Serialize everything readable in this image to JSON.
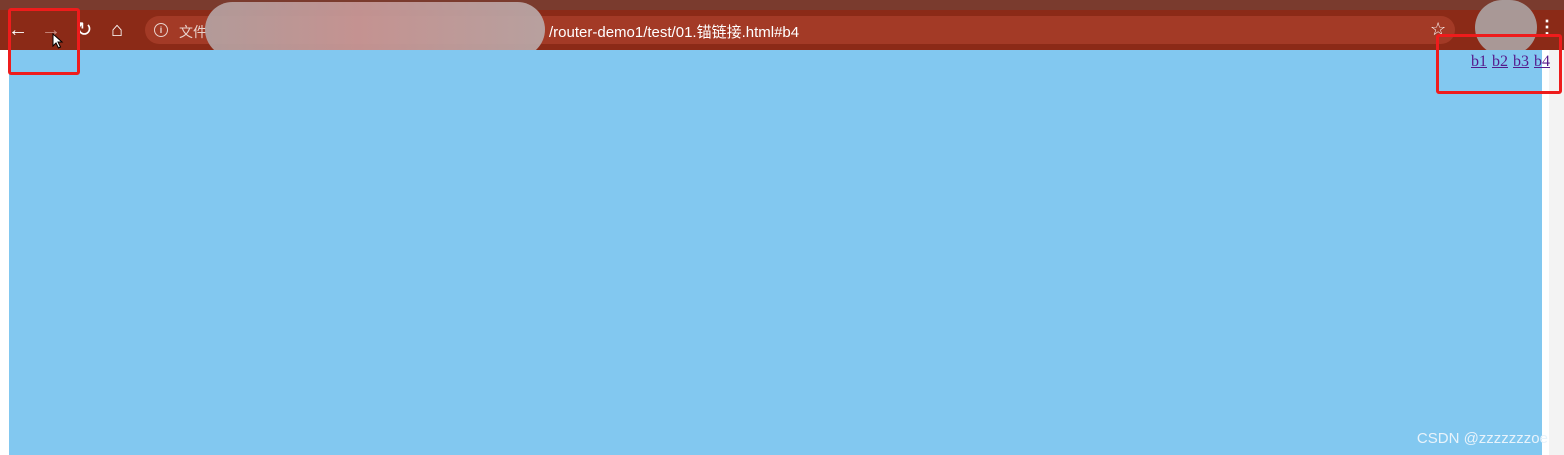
{
  "browser": {
    "nav": {
      "back_glyph": "←",
      "forward_glyph": "→",
      "reload_glyph": "↻",
      "home_glyph": "⌂"
    },
    "omnibox": {
      "file_label": "文件",
      "url": "/router-demo1/test/01.锚链接.html#b4"
    },
    "star_glyph": "☆",
    "menu_glyph": "⋮"
  },
  "page": {
    "background_color": "#82c8f0",
    "anchors": [
      "b1",
      "b2",
      "b3",
      "b4"
    ]
  },
  "watermark": "CSDN @zzzzzzzoe",
  "colors": {
    "toolbar": "#8b2a17",
    "highlight": "#ee1c1c",
    "link_visited": "#551a8b"
  }
}
